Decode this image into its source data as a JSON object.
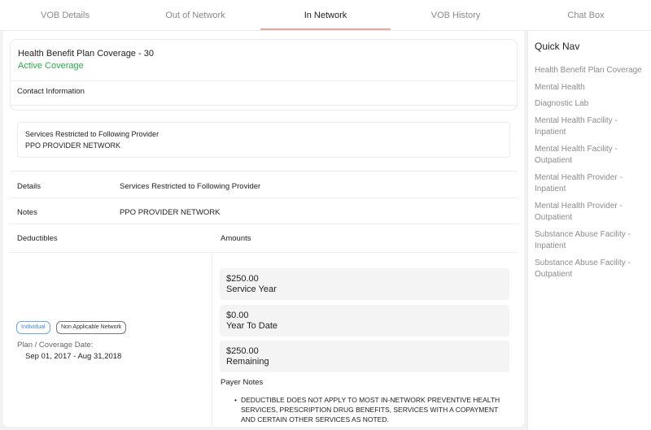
{
  "tabs": [
    {
      "label": "VOB Details"
    },
    {
      "label": "Out of Network"
    },
    {
      "label": "In Network"
    },
    {
      "label": "VOB History"
    },
    {
      "label": "Chat Box"
    }
  ],
  "plan": {
    "title": "Health Benefit Plan Coverage - 30",
    "status": "Active Coverage"
  },
  "contact": {
    "title": "Contact Information",
    "restriction_title": "Services Restricted to Following Provider",
    "restriction_value": "PPO PROVIDER NETWORK"
  },
  "details": {
    "label": "Details",
    "value": "Services Restricted to Following Provider"
  },
  "notes": {
    "label": "Notes",
    "value": "PPO PROVIDER NETWORK"
  },
  "deductibles": {
    "header": "Deductibles",
    "badges": [
      "Individual",
      "Non Applicable Network"
    ],
    "date_label": "Plan / Coverage Date:",
    "date_value": "Sep 01, 2017 - Aug 31,2018"
  },
  "amounts": {
    "header": "Amounts",
    "items": [
      {
        "value": "$250.00",
        "label": "Service Year"
      },
      {
        "value": "$0.00",
        "label": "Year To Date"
      },
      {
        "value": "$250.00",
        "label": "Remaining"
      }
    ]
  },
  "payer_notes": {
    "title": "Payer Notes",
    "items": [
      "DEDUCTIBLE DOES NOT APPLY TO MOST IN-NETWORK PREVENTIVE HEALTH SERVICES, PRESCRIPTION DRUG BENEFITS, SERVICES WITH A COPAYMENT AND CERTAIN OTHER SERVICES AS NOTED."
    ]
  },
  "quick_nav": {
    "title": "Quick Nav",
    "items": [
      "Health Benefit Plan Coverage",
      "Mental Health",
      "Diagnostic Lab",
      "Mental Health Facility - Inpatient",
      "Mental Health Facility - Outpatient",
      "Mental Health Provider - Inpatient",
      "Mental Health Provider - Outpatient",
      "Substance Abuse Facility - Inpatient",
      "Substance Abuse Facility - Outpatient"
    ]
  },
  "colors": {
    "active_tab_underline": "#f0a39a",
    "active_coverage": "#2eaa4c",
    "individual_badge": "#3f88d6"
  }
}
